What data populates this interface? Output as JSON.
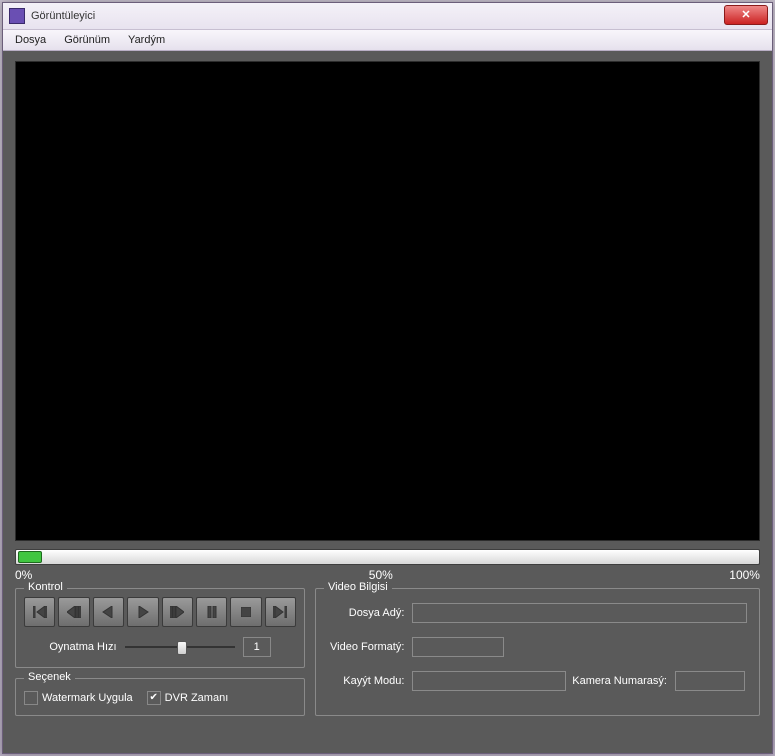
{
  "window": {
    "title": "Görüntüleyici"
  },
  "menu": {
    "file": "Dosya",
    "view": "Görünüm",
    "help": "Yardým"
  },
  "progress": {
    "p0": "0%",
    "p50": "50%",
    "p100": "100%"
  },
  "control": {
    "group": "Kontrol",
    "speed_label": "Oynatma Hızı",
    "speed_value": "1"
  },
  "option": {
    "group": "Seçenek",
    "watermark": "Watermark Uygula",
    "dvr_time": "DVR Zamanı"
  },
  "info": {
    "group": "Video Bilgisi",
    "file_name": "Dosya Adý:",
    "video_format": "Video Formatý:",
    "record_mode": "Kayýt Modu:",
    "camera_number": "Kamera Numarasý:"
  }
}
